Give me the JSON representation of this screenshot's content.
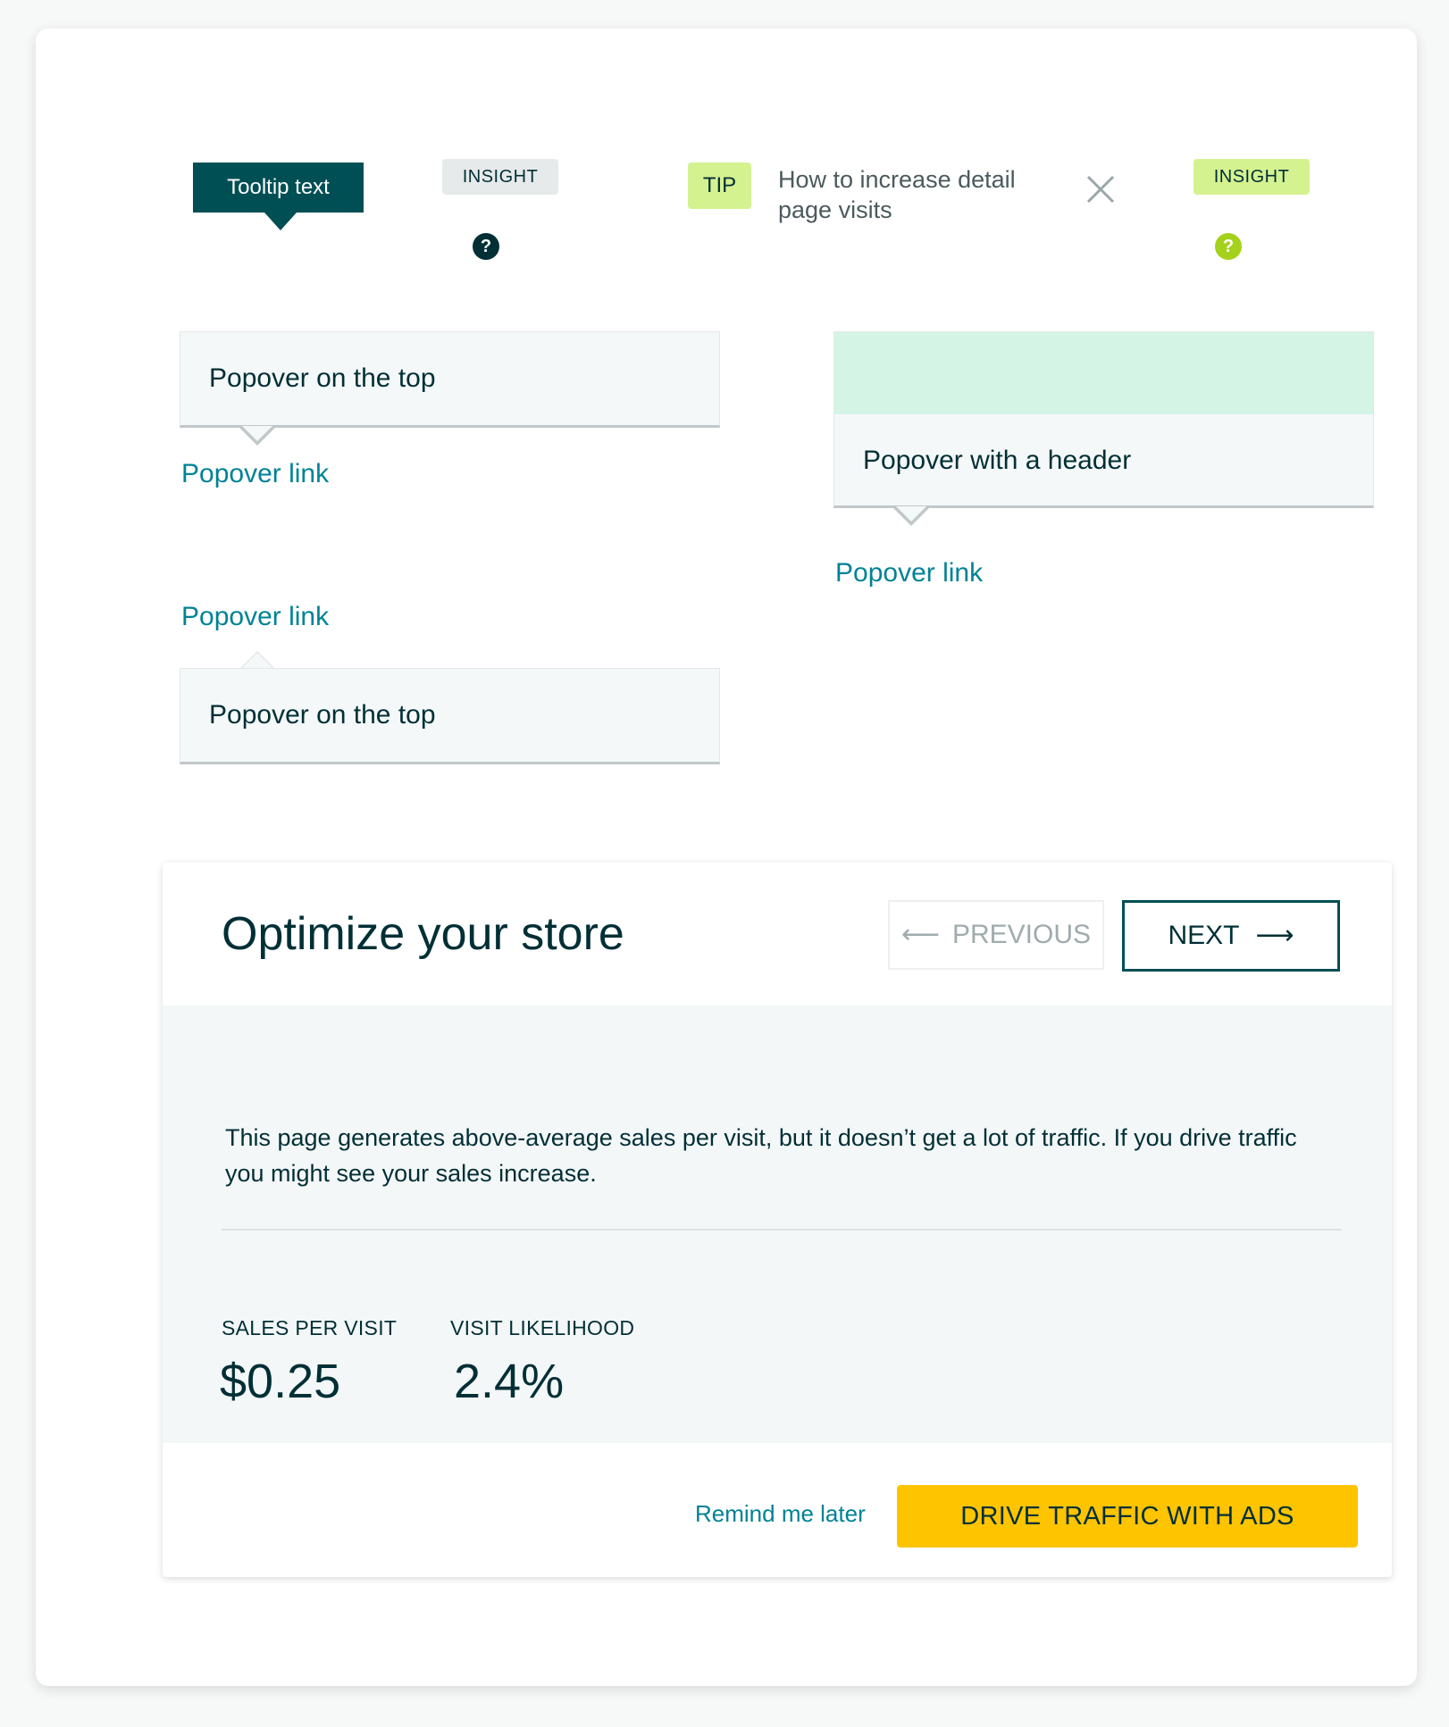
{
  "tooltip": {
    "text": "Tooltip text"
  },
  "insight_gray": {
    "label": "INSIGHT",
    "icon": "help-icon"
  },
  "tip": {
    "badge": "TIP",
    "text": "How to increase detail page visits",
    "close_icon": "close-icon"
  },
  "insight_green": {
    "label": "INSIGHT",
    "icon": "help-icon"
  },
  "popovers": {
    "top_left": {
      "text": "Popover on the top",
      "link": "Popover link"
    },
    "header": {
      "text": "Popover with a header",
      "link": "Popover link"
    },
    "bottom_left": {
      "text": "Popover on the top",
      "link": "Popover link"
    }
  },
  "optimize": {
    "title": "Optimize your store",
    "prev_label": "PREVIOUS",
    "next_label": "NEXT",
    "description": "This page generates above-average sales per visit, but it doesn’t get a lot of traffic. If you drive traffic you might see your sales increase.",
    "metrics": [
      {
        "label": "SALES PER VISIT",
        "value": "$0.25"
      },
      {
        "label": "VISIT LIKELIHOOD",
        "value": "2.4%"
      }
    ],
    "remind_label": "Remind me later",
    "cta_label": "DRIVE TRAFFIC WITH ADS"
  },
  "colors": {
    "dark_teal": "#004f54",
    "link_teal": "#008296",
    "tip_green": "#d5f290",
    "cta_yellow": "#ffc400",
    "header_mint": "#d4f5e6"
  }
}
